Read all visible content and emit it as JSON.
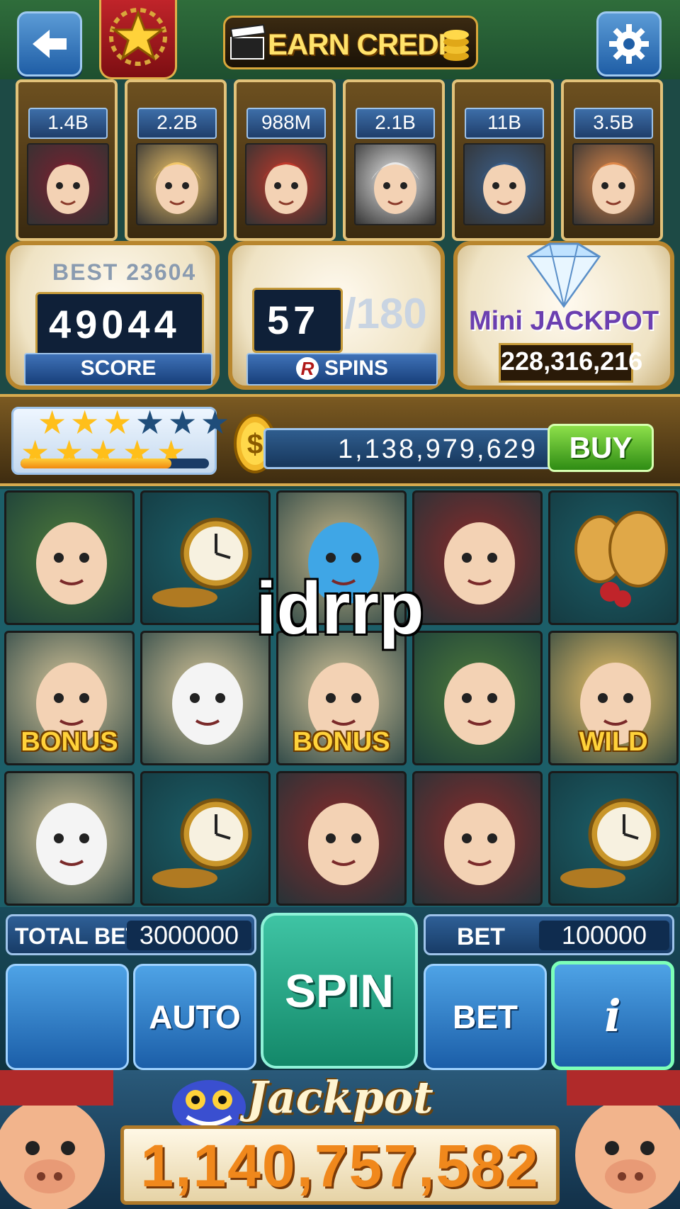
{
  "header": {
    "earn_credit_label": "EARN CREDIT",
    "back_icon": "back-arrow-icon",
    "settings_icon": "gear-icon",
    "rank_icon": "gold-star-icon"
  },
  "players": [
    {
      "amount": "1.4B",
      "avatar": "vampire-avatar",
      "color": "#7a2030"
    },
    {
      "amount": "2.2B",
      "avatar": "blonde-woman-avatar",
      "color": "#f3c76a"
    },
    {
      "amount": "988M",
      "avatar": "geisha-avatar",
      "color": "#c0392b"
    },
    {
      "amount": "2.1B",
      "avatar": "panda-avatar",
      "color": "#eaeaea"
    },
    {
      "amount": "11B",
      "avatar": "boy-with-cap-avatar",
      "color": "#3b5f8a"
    },
    {
      "amount": "3.5B",
      "avatar": "redhead-woman-avatar",
      "color": "#e0894a"
    }
  ],
  "score": {
    "best_label": "BEST 23604",
    "value": "49044",
    "label": "SCORE"
  },
  "spins": {
    "value": "57",
    "total": "/180",
    "label": "SPINS",
    "badge": "R"
  },
  "mini_jackpot": {
    "label": "Mini JACKPOT",
    "value": "228,316,216"
  },
  "level": {
    "stars_filled": 8,
    "stars_total": 11,
    "progress": 0.8
  },
  "balance": {
    "coins": "1,138,979,629",
    "buy_label": "BUY",
    "coin_icon": "dollar-coin-icon"
  },
  "reels": [
    [
      {
        "sym": "mad-hatter",
        "label": ""
      },
      {
        "sym": "pocket-watch",
        "label": ""
      },
      {
        "sym": "blue-caterpillar",
        "label": ""
      },
      {
        "sym": "red-queen",
        "label": ""
      },
      {
        "sym": "butterfly-cookie",
        "label": ""
      }
    ],
    [
      {
        "sym": "card-soldiers",
        "label": "BONUS"
      },
      {
        "sym": "white-rabbit",
        "label": ""
      },
      {
        "sym": "card-soldiers",
        "label": "BONUS"
      },
      {
        "sym": "mad-hatter",
        "label": ""
      },
      {
        "sym": "alice",
        "label": "WILD"
      }
    ],
    [
      {
        "sym": "white-rabbit",
        "label": ""
      },
      {
        "sym": "pocket-watch",
        "label": ""
      },
      {
        "sym": "red-queen",
        "label": ""
      },
      {
        "sym": "red-queen",
        "label": ""
      },
      {
        "sym": "pocket-watch",
        "label": ""
      }
    ]
  ],
  "overlay_text": "idrrp",
  "controls": {
    "total_bet_label": "TOTAL BET",
    "total_bet_value": "3000000",
    "bet_label": "BET",
    "bet_value": "100000",
    "auto_label": "AUTO",
    "spin_label": "SPIN",
    "bet_button_label": "BET",
    "info_label": "i"
  },
  "jackpot": {
    "label": "Jackpot",
    "value": "1,140,757,582"
  }
}
